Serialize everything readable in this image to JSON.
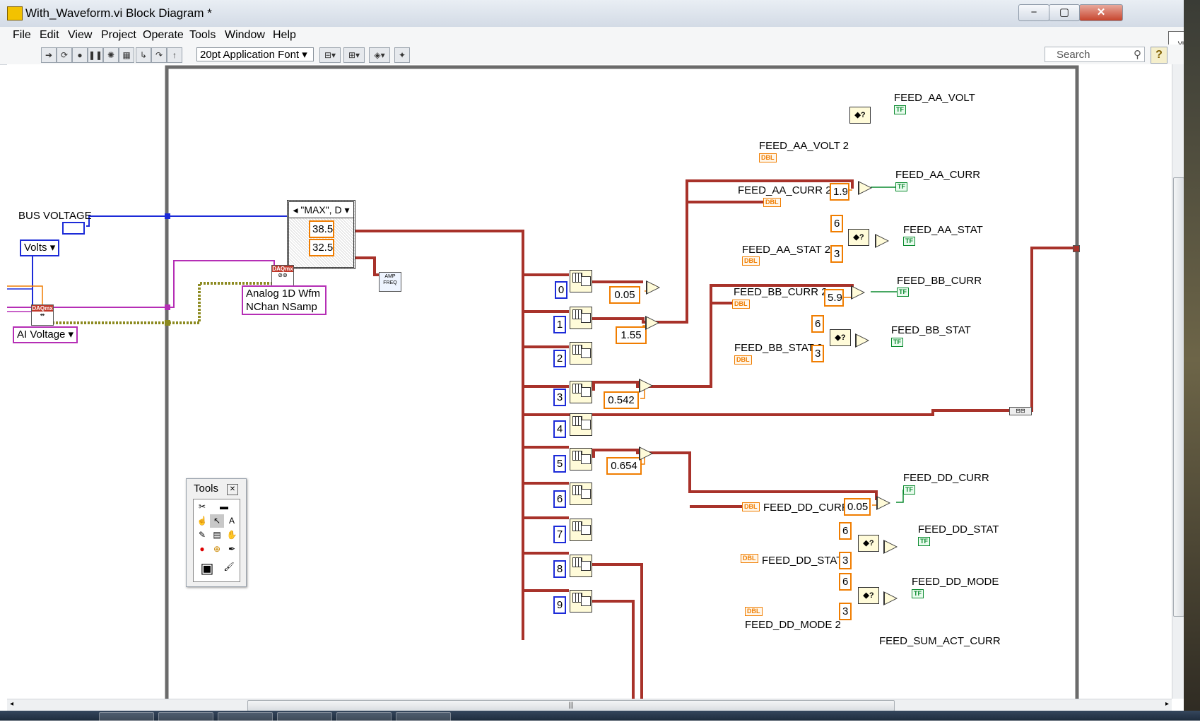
{
  "window": {
    "title": "With_Waveform.vi Block Diagram *",
    "min_label": "−",
    "max_label": "▢",
    "close_label": "✕"
  },
  "menu": [
    "File",
    "Edit",
    "View",
    "Project",
    "Operate",
    "Tools",
    "Window",
    "Help"
  ],
  "toolbar": {
    "font": "20pt Application Font",
    "search_placeholder": "Search",
    "help_label": "?"
  },
  "diagram": {
    "bus_voltage_label": "BUS VOLTAGE",
    "volts_label": "Volts",
    "ai_voltage_label": "AI Voltage",
    "daqmx_read_label": "Analog 1D Wfm\nNChan NSamp",
    "case_selector": "\"MAX\", D",
    "case_consts": [
      "38.5",
      "32.5"
    ],
    "indices": [
      "0",
      "1",
      "2",
      "3",
      "4",
      "5",
      "6",
      "7",
      "8",
      "9"
    ],
    "thresholds": [
      "0.05",
      "1.55",
      "0.542",
      "0.654"
    ],
    "feed_aa_volt": "FEED_AA_VOLT",
    "feed_aa_volt2": "FEED_AA_VOLT  2",
    "feed_aa_curr": "FEED_AA_CURR",
    "feed_aa_curr2": "FEED_AA_CURR  2",
    "feed_aa_curr_const": "1.9",
    "feed_aa_stat": "FEED_AA_STAT",
    "feed_aa_stat2": "FEED_AA_STAT  2",
    "feed_aa_stat_consts": [
      "6",
      "3"
    ],
    "feed_bb_curr": "FEED_BB_CURR",
    "feed_bb_curr2": "FEED_BB_CURR  2",
    "feed_bb_curr_const": "5.9",
    "feed_bb_stat": "FEED_BB_STAT",
    "feed_bb_stat2": "FEED_BB_STAT  2",
    "feed_bb_stat_consts": [
      "6",
      "3"
    ],
    "feed_dd_curr": "FEED_DD_CURR",
    "feed_dd_curr2": "FEED_DD_CURR  2",
    "feed_dd_curr_const": "0.05",
    "feed_dd_stat": "FEED_DD_STAT",
    "feed_dd_stat2": "FEED_DD_STAT  2",
    "feed_dd_stat_consts": [
      "6",
      "3"
    ],
    "feed_dd_mode": "FEED_DD_MODE",
    "feed_dd_mode2": "FEED_DD_MODE  2",
    "feed_dd_mode_consts": [
      "6",
      "3"
    ],
    "feed_sum_act_curr": "FEED_SUM_ACT_CURR",
    "dbl_tag": "DBL",
    "tf_tag": "TF",
    "amp_freq_label": "AMP FREQ",
    "daqmx_tag": "DAQmx"
  },
  "tools_palette": {
    "title": "Tools",
    "close_label": "✕"
  },
  "colors": {
    "wire_dynamic": "#a8322a",
    "wire_dbl": "#f07d00",
    "wire_bool": "#0a8a2e",
    "wire_int": "#1c2bd8",
    "wire_task": "#b52eb5"
  },
  "icons": [
    "run-arrow-icon",
    "run-continuous-icon",
    "abort-icon",
    "pause-icon",
    "highlight-bulb-icon",
    "retain-values-icon",
    "step-into-icon",
    "step-over-icon",
    "step-out-icon",
    "align-icon",
    "distribute-icon",
    "reorder-icon",
    "cleanup-icon",
    "search-icon",
    "help-icon"
  ]
}
